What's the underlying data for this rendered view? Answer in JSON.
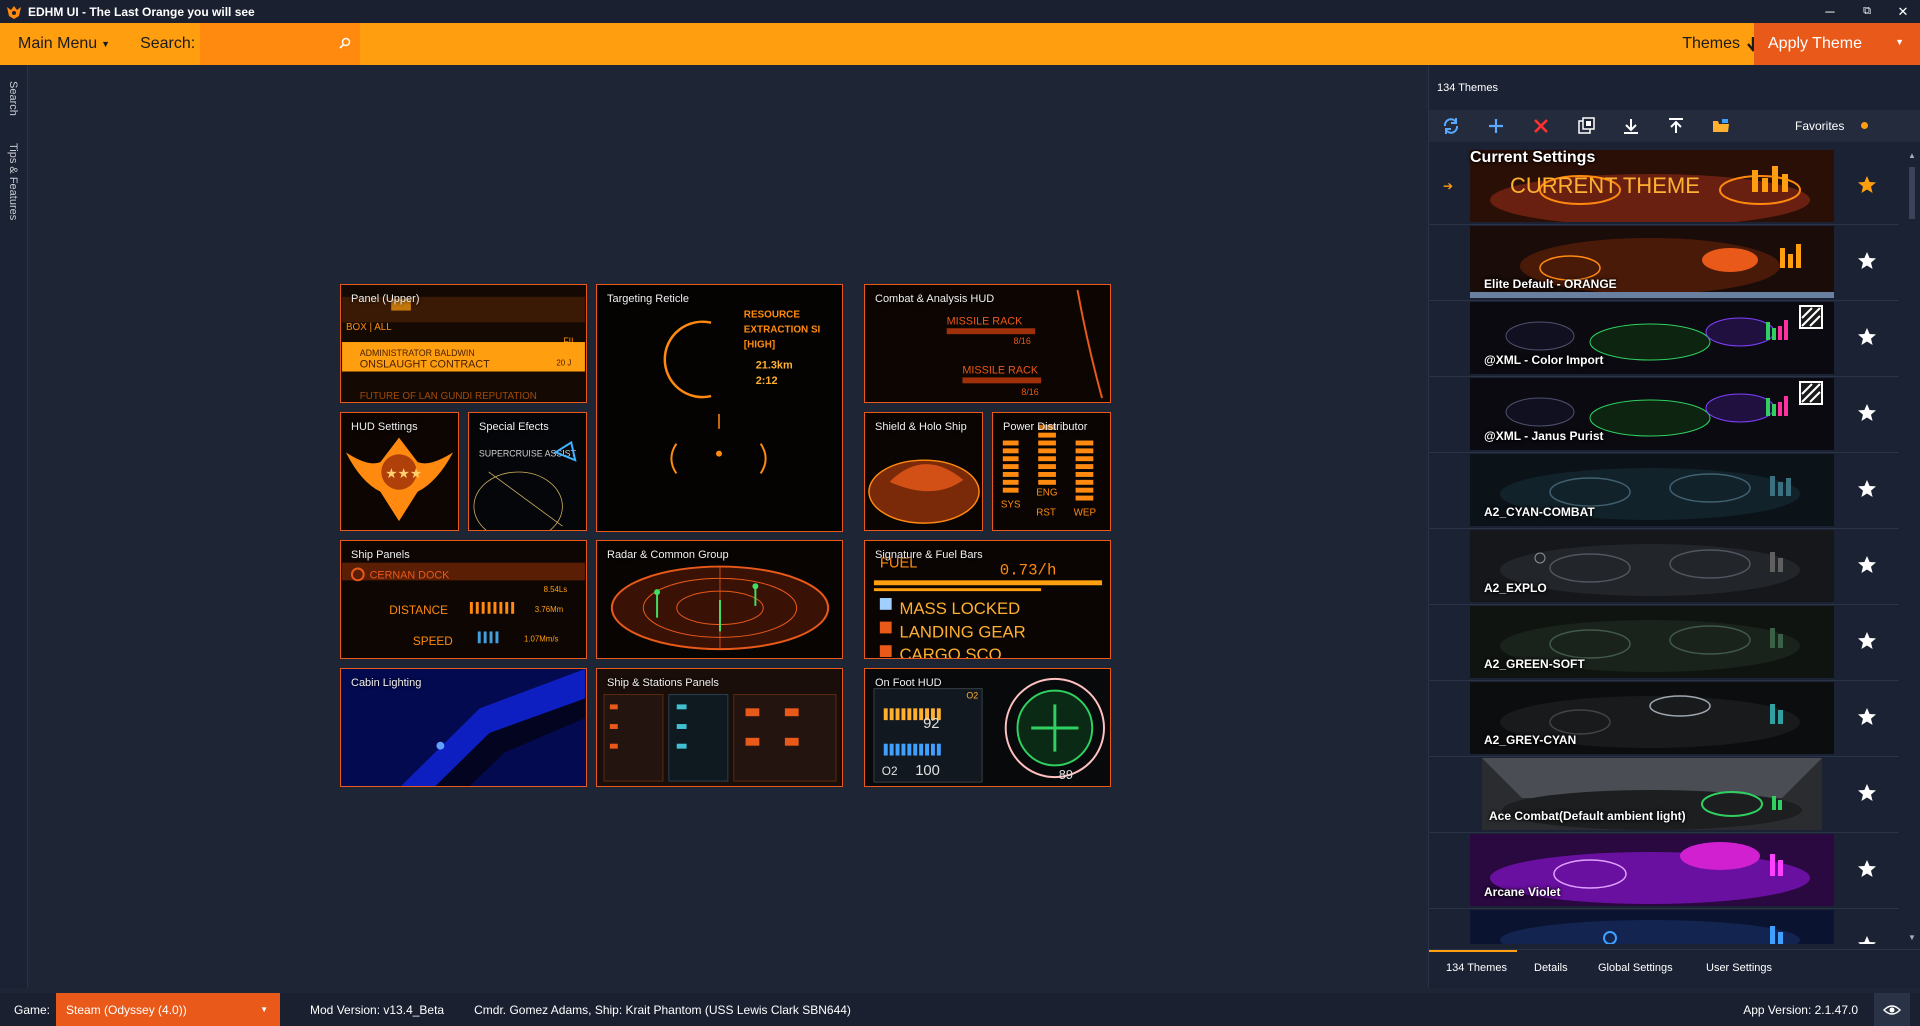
{
  "window": {
    "title": "EDHM UI - The Last Orange you will see",
    "minimize": "─",
    "restore": "⧉",
    "close": "✕"
  },
  "toolbar": {
    "main_menu": "Main Menu",
    "search_label": "Search:",
    "search_value": "",
    "themes": "Themes",
    "apply_theme": "Apply Theme"
  },
  "left_tabs": [
    "Search",
    "Tips & Features"
  ],
  "tiles": [
    {
      "label": "Panel (Upper)"
    },
    {
      "label": "Targeting Reticle"
    },
    {
      "label": "Combat & Analysis HUD"
    },
    {
      "label": "HUD Settings"
    },
    {
      "label": "Special Efects"
    },
    {
      "label": "Shield & Holo Ship"
    },
    {
      "label": "Power Distributor"
    },
    {
      "label": "Ship Panels"
    },
    {
      "label": "Radar & Common Group"
    },
    {
      "label": "Signature & Fuel Bars"
    },
    {
      "label": "Cabin Lighting"
    },
    {
      "label": "Ship & Stations Panels"
    },
    {
      "label": "On Foot HUD"
    }
  ],
  "tile_art": {
    "panel_upper": [
      "BOX | ALL",
      "ADMINISTRATOR BALDWIN",
      "ONSLAUGHT CONTRACT",
      "FUTURE OF LAN GUNDI REPUTATION",
      "FIL",
      "20 J"
    ],
    "reticle": [
      "RESOURCE",
      "EXTRACTION SI",
      "[HIGH]",
      "21.3km",
      "2:12"
    ],
    "combat": [
      "MISSILE RACK",
      "8/16",
      "MISSILE RACK",
      "8/16"
    ],
    "special": "SUPERCRUISE ASSIST",
    "power": [
      "SYS",
      "ENG",
      "RST",
      "WEP"
    ],
    "ship_panels": [
      "CERNAN DOCK",
      "DISTANCE",
      "SPEED",
      "8.54Ls",
      "3.76Mm",
      "1.07Mm/s"
    ],
    "fuel": [
      "FUEL",
      "0.73/h",
      "MASS LOCKED",
      "LANDING GEAR",
      "CARGO SCO"
    ],
    "onfoot": [
      "92",
      "100",
      "89",
      "O2",
      "O2"
    ]
  },
  "right_panel": {
    "count": "134 Themes",
    "favorites": "Favorites",
    "themes": [
      {
        "name": "Current Settings",
        "banner": "CURRENT THEME",
        "current": true
      },
      {
        "name": "Elite Default - ORANGE"
      },
      {
        "name": "@XML - Color Import"
      },
      {
        "name": "@XML - Janus Purist"
      },
      {
        "name": "A2_CYAN-COMBAT"
      },
      {
        "name": "A2_EXPLO"
      },
      {
        "name": "A2_GREEN-SOFT"
      },
      {
        "name": "A2_GREY-CYAN"
      },
      {
        "name": "Ace Combat(Default ambient light)"
      },
      {
        "name": "Arcane Violet"
      }
    ],
    "tabs": [
      "134 Themes",
      "Details",
      "Global Settings",
      "User Settings"
    ]
  },
  "statusbar": {
    "game_label": "Game:",
    "game_value": "Steam (Odyssey (4.0))",
    "mod_version": "Mod Version: v13.4_Beta",
    "cmdr": "Cmdr. Gomez Adams, Ship: Krait Phantom (USS Lewis  Clark SBN644)",
    "app_version": "App Version: 2.1.47.0"
  },
  "colors": {
    "accent": "#ff9f0f",
    "accent_dark": "#e8591a",
    "background": "#1e2535",
    "panel": "#1b2233"
  }
}
